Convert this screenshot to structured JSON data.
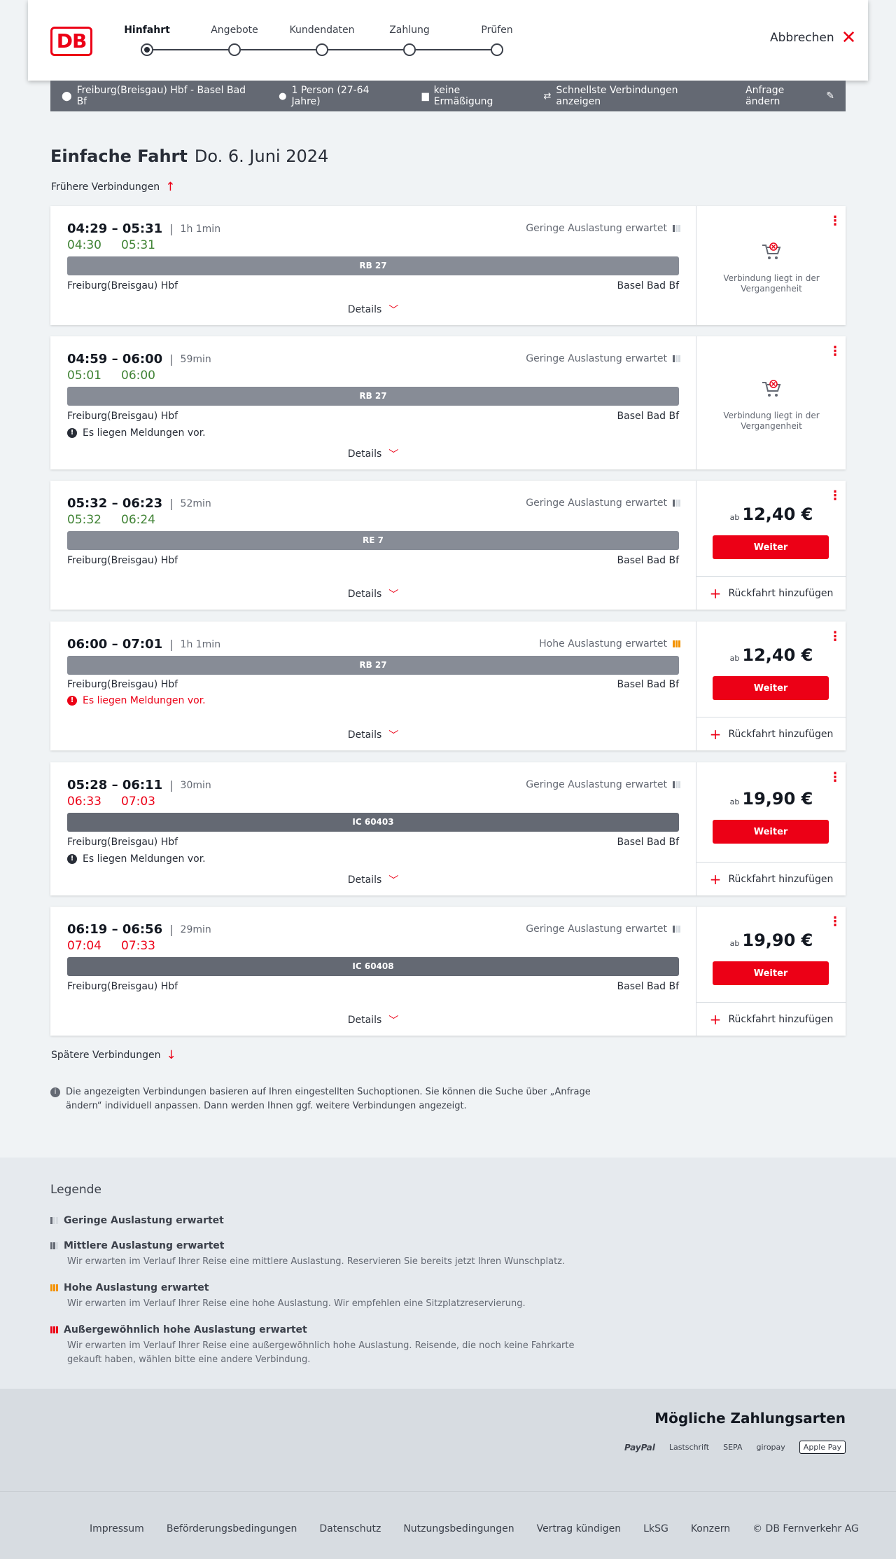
{
  "brand": {
    "logo": "DB",
    "accent": "#ec0016"
  },
  "steps": [
    {
      "label": "Hinfahrt",
      "active": true
    },
    {
      "label": "Angebote",
      "active": false
    },
    {
      "label": "Kundendaten",
      "active": false
    },
    {
      "label": "Zahlung",
      "active": false
    },
    {
      "label": "Prüfen",
      "active": false
    }
  ],
  "header": {
    "cancel_label": "Abbrechen"
  },
  "query": {
    "route": "Freiburg(Breisgau) Hbf - Basel Bad Bf",
    "persons": "1 Person (27-64 Jahre)",
    "discount": "keine Ermäßigung",
    "fastest": "Schnellste Verbindungen anzeigen",
    "change": "Anfrage ändern"
  },
  "title": {
    "type": "Einfache Fahrt",
    "date": "Do. 6. Juni 2024"
  },
  "nav": {
    "earlier": "Frühere Verbindungen",
    "later": "Spätere Verbindungen"
  },
  "labels": {
    "details": "Details",
    "weiter": "Weiter",
    "return": "Rückfahrt hinzufügen",
    "past": "Verbindung liegt in der Vergangenheit",
    "ab": "ab"
  },
  "connections": [
    {
      "dep": "04:29",
      "arr": "05:31",
      "duration": "1h 1min",
      "rt_dep": "04:30",
      "rt_arr": "05:31",
      "rt_state": "green",
      "load": "Geringe Auslastung erwartet",
      "load_level": "low",
      "train": "RB 27",
      "kind": "rb",
      "from": "Freiburg(Breisgau) Hbf",
      "to": "Basel Bad Bf",
      "message": "",
      "bookable": false,
      "price": ""
    },
    {
      "dep": "04:59",
      "arr": "06:00",
      "duration": "59min",
      "rt_dep": "05:01",
      "rt_arr": "06:00",
      "rt_state": "green",
      "load": "Geringe Auslastung erwartet",
      "load_level": "low",
      "train": "RB 27",
      "kind": "rb",
      "from": "Freiburg(Breisgau) Hbf",
      "to": "Basel Bad Bf",
      "message": "Es liegen Meldungen vor.",
      "message_state": "normal",
      "bookable": false,
      "price": ""
    },
    {
      "dep": "05:32",
      "arr": "06:23",
      "duration": "52min",
      "rt_dep": "05:32",
      "rt_arr": "06:24",
      "rt_state": "green",
      "load": "Geringe Auslastung erwartet",
      "load_level": "low",
      "train": "RE 7",
      "kind": "rb",
      "from": "Freiburg(Breisgau) Hbf",
      "to": "Basel Bad Bf",
      "message": "",
      "bookable": true,
      "price": "12,40 €"
    },
    {
      "dep": "06:00",
      "arr": "07:01",
      "duration": "1h 1min",
      "rt_dep": "",
      "rt_arr": "",
      "rt_state": "none",
      "load": "Hohe Auslastung erwartet",
      "load_level": "high",
      "train": "RB 27",
      "kind": "rb",
      "from": "Freiburg(Breisgau) Hbf",
      "to": "Basel Bad Bf",
      "message": "Es liegen Meldungen vor.",
      "message_state": "red",
      "bookable": true,
      "price": "12,40 €"
    },
    {
      "dep": "05:28",
      "arr": "06:11",
      "duration": "30min",
      "rt_dep": "06:33",
      "rt_arr": "07:03",
      "rt_state": "red",
      "load": "Geringe Auslastung erwartet",
      "load_level": "low",
      "train": "IC 60403",
      "kind": "ic",
      "from": "Freiburg(Breisgau) Hbf",
      "to": "Basel Bad Bf",
      "message": "Es liegen Meldungen vor.",
      "message_state": "normal",
      "bookable": true,
      "price": "19,90 €"
    },
    {
      "dep": "06:19",
      "arr": "06:56",
      "duration": "29min",
      "rt_dep": "07:04",
      "rt_arr": "07:33",
      "rt_state": "red",
      "load": "Geringe Auslastung erwartet",
      "load_level": "low",
      "train": "IC 60408",
      "kind": "ic",
      "from": "Freiburg(Breisgau) Hbf",
      "to": "Basel Bad Bf",
      "message": "",
      "bookable": true,
      "price": "19,90 €"
    }
  ],
  "info_text": "Die angezeigten Verbindungen basieren auf Ihren eingestellten Suchoptionen. Sie können die Suche über „Anfrage ändern“ individuell anpassen. Dann werden Ihnen ggf. weitere Verbindungen angezeigt.",
  "legend": {
    "title": "Legende",
    "items": [
      {
        "title": "Geringe Auslastung erwartet",
        "desc": "",
        "level": "low"
      },
      {
        "title": "Mittlere Auslastung erwartet",
        "desc": "Wir erwarten im Verlauf Ihrer Reise eine mittlere Auslastung. Reservieren Sie bereits jetzt Ihren Wunschplatz.",
        "level": "mid"
      },
      {
        "title": "Hohe Auslastung erwartet",
        "desc": "Wir erwarten im Verlauf Ihrer Reise eine hohe Auslastung. Wir empfehlen eine Sitzplatzreservierung.",
        "level": "high"
      },
      {
        "title": "Außergewöhnlich hohe Auslastung erwartet",
        "desc": "Wir erwarten im Verlauf Ihrer Reise eine außergewöhnlich hohe Auslastung. Reisende, die noch keine Fahrkarte gekauft haben, wählen bitte eine andere Verbindung.",
        "level": "ext"
      }
    ]
  },
  "payment": {
    "title": "Mögliche Zahlungsarten",
    "methods": [
      "PayPal",
      "Lastschrift",
      "SEPA",
      "giropay",
      "Apple Pay"
    ]
  },
  "footer": {
    "links": [
      "Impressum",
      "Beförderungsbedingungen",
      "Datenschutz",
      "Nutzungsbedingungen",
      "Vertrag kündigen",
      "LkSG",
      "Konzern",
      "© DB Fernverkehr AG"
    ]
  }
}
